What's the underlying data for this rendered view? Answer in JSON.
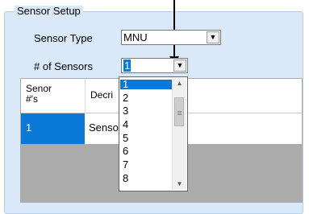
{
  "group": {
    "title": "Sensor Setup"
  },
  "sensor_type": {
    "label": "Sensor Type",
    "value": "MNU"
  },
  "num_sensors": {
    "label": "# of Sensors",
    "value": "1"
  },
  "grid": {
    "columns": [
      "Senor\n#'s",
      "Decri"
    ],
    "rows": [
      {
        "num": "1",
        "desc": "Senso"
      }
    ]
  },
  "dropdown": {
    "options": [
      "1",
      "2",
      "3",
      "4",
      "5",
      "6",
      "7",
      "8"
    ],
    "selected_index": 0
  },
  "icons": {
    "combo_arrow": "chevron-down-icon",
    "scroll_up": "scroll-up-arrow-icon",
    "scroll_down": "scroll-down-arrow-icon"
  },
  "colors": {
    "group_bg": "#d9e9fa",
    "selection": "#0a78d7"
  }
}
